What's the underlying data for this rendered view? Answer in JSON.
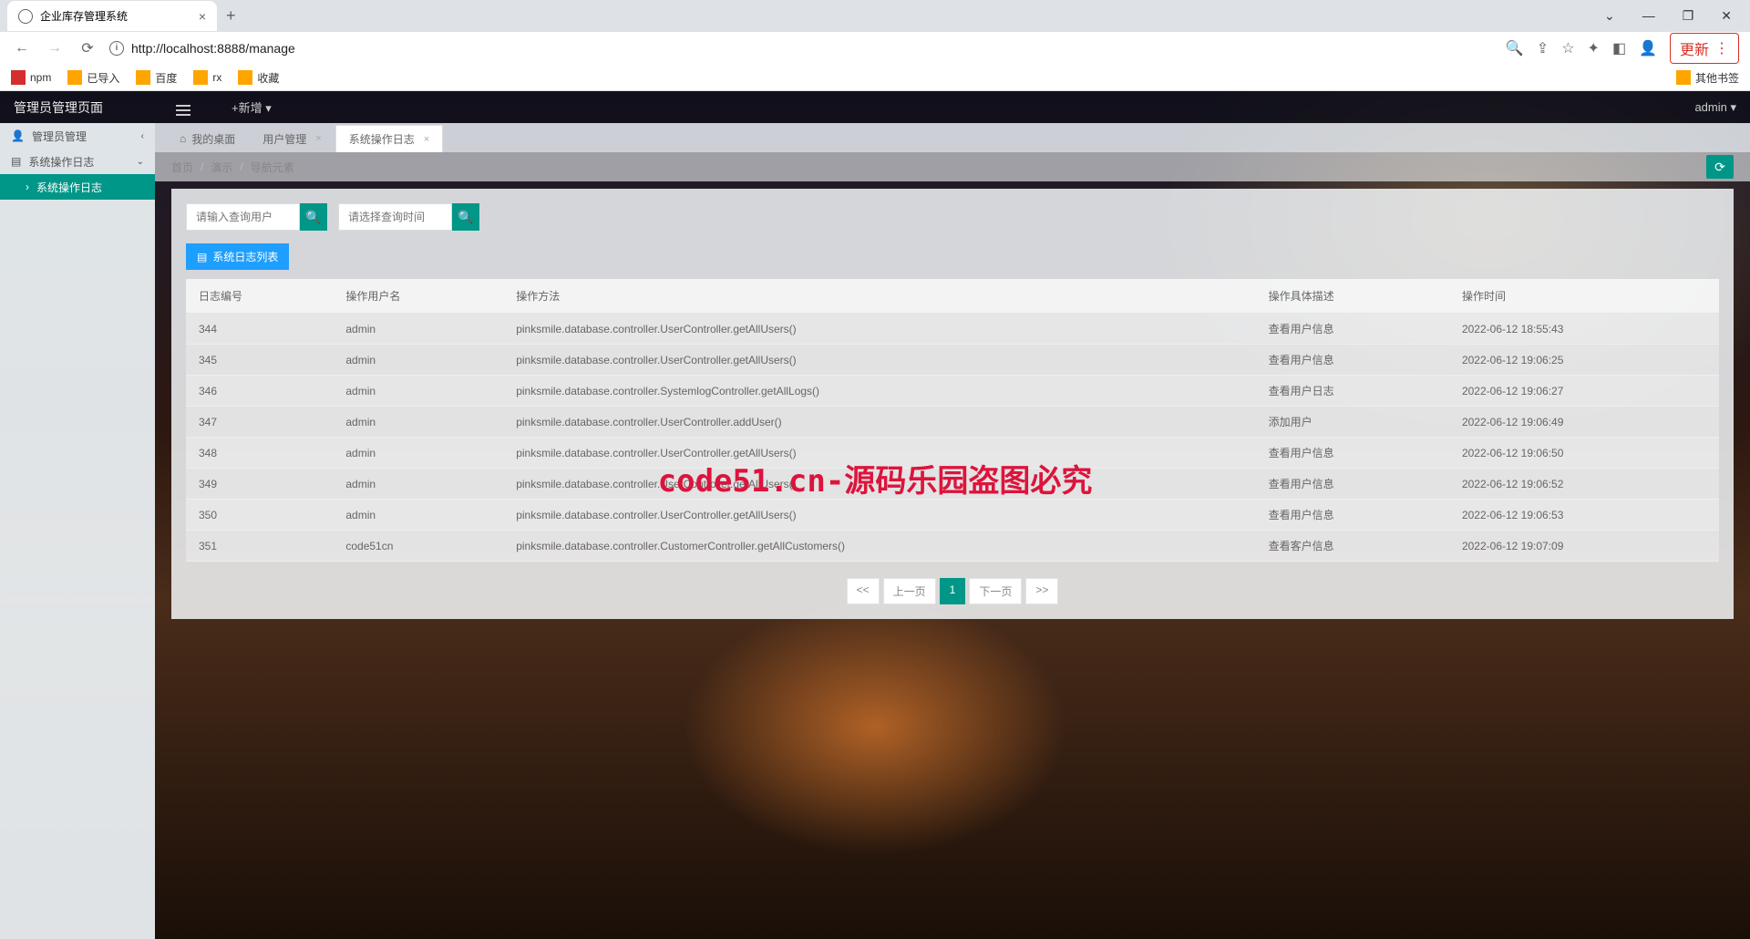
{
  "browser": {
    "tab_title": "企业库存管理系统",
    "url_display": "http://localhost:8888/manage",
    "update_label": "更新",
    "bookmarks": [
      "npm",
      "已导入",
      "百度",
      "rx",
      "收藏"
    ],
    "other_bookmarks": "其他书签"
  },
  "app": {
    "title": "管理员管理页面",
    "add_new": "+新增",
    "user": "admin"
  },
  "sidebar": {
    "items": [
      {
        "label": "管理员管理",
        "expandable": true,
        "expanded": false
      },
      {
        "label": "系统操作日志",
        "expandable": true,
        "expanded": true
      },
      {
        "label": "系统操作日志",
        "active": true
      }
    ]
  },
  "tabs": [
    {
      "label": "我的桌面",
      "icon": "home",
      "closable": false,
      "active": false
    },
    {
      "label": "用户管理",
      "closable": true,
      "active": false
    },
    {
      "label": "系统操作日志",
      "closable": true,
      "active": true
    }
  ],
  "breadcrumb": {
    "items": [
      "首页",
      "演示",
      "导航元素"
    ]
  },
  "search": {
    "user_placeholder": "请输入查询用户",
    "time_placeholder": "请选择查询时间"
  },
  "list_badge": "系统日志列表",
  "table": {
    "columns": [
      "日志编号",
      "操作用户名",
      "操作方法",
      "操作具体描述",
      "操作时间"
    ],
    "rows": [
      {
        "id": "344",
        "user": "admin",
        "method": "pinksmile.database.controller.UserController.getAllUsers()",
        "desc": "查看用户信息",
        "time": "2022-06-12 18:55:43"
      },
      {
        "id": "345",
        "user": "admin",
        "method": "pinksmile.database.controller.UserController.getAllUsers()",
        "desc": "查看用户信息",
        "time": "2022-06-12 19:06:25"
      },
      {
        "id": "346",
        "user": "admin",
        "method": "pinksmile.database.controller.SystemlogController.getAllLogs()",
        "desc": "查看用户日志",
        "time": "2022-06-12 19:06:27"
      },
      {
        "id": "347",
        "user": "admin",
        "method": "pinksmile.database.controller.UserController.addUser()",
        "desc": "添加用户",
        "time": "2022-06-12 19:06:49"
      },
      {
        "id": "348",
        "user": "admin",
        "method": "pinksmile.database.controller.UserController.getAllUsers()",
        "desc": "查看用户信息",
        "time": "2022-06-12 19:06:50"
      },
      {
        "id": "349",
        "user": "admin",
        "method": "pinksmile.database.controller.UserController.getAllUsers()",
        "desc": "查看用户信息",
        "time": "2022-06-12 19:06:52"
      },
      {
        "id": "350",
        "user": "admin",
        "method": "pinksmile.database.controller.UserController.getAllUsers()",
        "desc": "查看用户信息",
        "time": "2022-06-12 19:06:53"
      },
      {
        "id": "351",
        "user": "code51cn",
        "method": "pinksmile.database.controller.CustomerController.getAllCustomers()",
        "desc": "查看客户信息",
        "time": "2022-06-12 19:07:09"
      }
    ]
  },
  "pagination": {
    "first": "<<",
    "prev": "上一页",
    "current": "1",
    "next": "下一页",
    "last": ">>"
  },
  "watermark": "code51.cn-源码乐园盗图必究"
}
